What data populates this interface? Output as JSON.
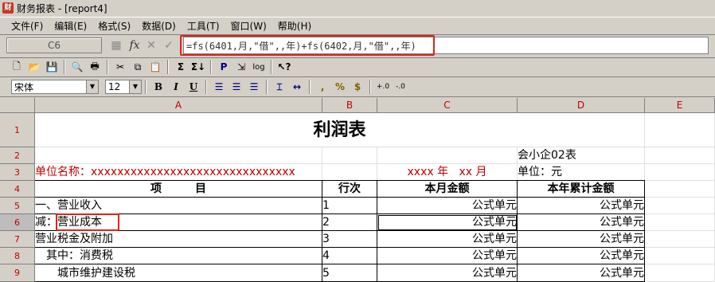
{
  "window": {
    "title": "财务报表 - [report4]"
  },
  "menu": [
    "文件(F)",
    "编辑(E)",
    "格式(S)",
    "数据(D)",
    "工具(T)",
    "窗口(W)",
    "帮助(H)"
  ],
  "formula_bar": {
    "cell_ref": "C6",
    "formula": "=fs(6401,月,\"借\",,年)+fs(6402,月,\"借\",,年)"
  },
  "format_bar": {
    "font": "宋体",
    "size": "12"
  },
  "columns": [
    "A",
    "B",
    "C",
    "D",
    "E"
  ],
  "rows": [
    "1",
    "2",
    "3",
    "4",
    "5",
    "6",
    "7",
    "8",
    "9"
  ],
  "report": {
    "title": "利润表",
    "form_no": "会小企02表",
    "unit_name": "单位名称：xxxxxxxxxxxxxxxxxxxxxxxxxxxxxxx",
    "period": "xxxx 年   xx 月",
    "unit": "单位：元",
    "headers": [
      "项　　　目",
      "行次",
      "本月金额",
      "本年累计金额"
    ],
    "lines": [
      {
        "item": "一、营业收入",
        "line": "1",
        "month": "公式单元",
        "ytd": "公式单元"
      },
      {
        "item": "减：营业成本",
        "line": "2",
        "month": "公式单元",
        "ytd": "公式单元"
      },
      {
        "item": "营业税金及附加",
        "line": "3",
        "month": "公式单元",
        "ytd": "公式单元"
      },
      {
        "item": "　其中：消费税",
        "line": "4",
        "month": "公式单元",
        "ytd": "公式单元"
      },
      {
        "item": "　　城市维护建设税",
        "line": "5",
        "month": "公式单元",
        "ytd": "公式单元"
      }
    ]
  },
  "colors": {
    "highlight": "#e0221b",
    "header_text": "#c00000"
  }
}
